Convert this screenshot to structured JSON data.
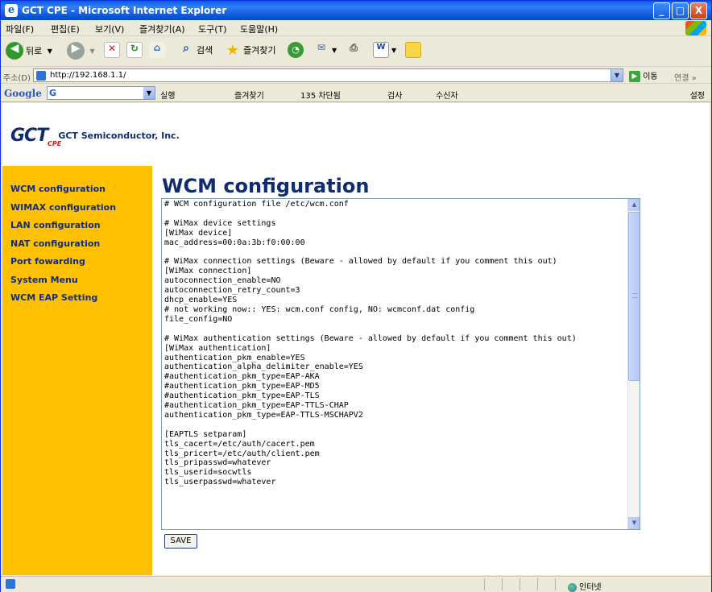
{
  "window": {
    "title": "GCT CPE - Microsoft Internet Explorer",
    "controls": {
      "minimize": "_",
      "maximize": "□",
      "close": "X"
    }
  },
  "menu": {
    "items": [
      "파일(F)",
      "편집(E)",
      "보기(V)",
      "즐겨찾기(A)",
      "도구(T)",
      "도움말(H)"
    ]
  },
  "toolbar": {
    "back_label": "뒤로",
    "search_label": "검색",
    "favorites_label": "즐겨찾기"
  },
  "address": {
    "label": "주소(D)",
    "url": "http://192.168.1.1/",
    "go_label": "이동",
    "links_label": "연결 »"
  },
  "google_toolbar": {
    "logo": "Google",
    "search_badge": "G",
    "items": [
      "실행",
      "즐겨찾기",
      "135 차단됨",
      "검사",
      "수신자"
    ],
    "settings_label": "설정"
  },
  "page": {
    "logo_mark": "GCT",
    "logo_sub": "CPE",
    "company": "GCT Semiconductor, Inc.",
    "title": "WCM configuration",
    "nav": [
      "WCM configuration",
      "WIMAX configuration",
      "LAN configuration",
      "NAT configuration",
      "Port fowarding",
      "System Menu",
      "WCM EAP Setting"
    ],
    "config_text": "# WCM configuration file /etc/wcm.conf\n\n# WiMax device settings\n[WiMax device]\nmac_address=00:0a:3b:f0:00:00\n\n# WiMax connection settings (Beware - allowed by default if you comment this out)\n[WiMax connection]\nautoconnection_enable=NO\nautoconnection_retry_count=3\ndhcp_enable=YES\n# not working now:: YES: wcm.conf config, NO: wcmconf.dat config\nfile_config=NO\n\n# WiMax authentication settings (Beware - allowed by default if you comment this out)\n[WiMax authentication]\nauthentication_pkm_enable=YES\nauthentication_alpha_delimiter_enable=YES\n#authentication_pkm_type=EAP-AKA\n#authentication_pkm_type=EAP-MD5\n#authentication_pkm_type=EAP-TLS\n#authentication_pkm_type=EAP-TTLS-CHAP\nauthentication_pkm_type=EAP-TTLS-MSCHAPV2\n\n[EAPTLS setparam]\ntls_cacert=/etc/auth/cacert.pem\ntls_pricert=/etc/auth/client.pem\ntls_pripasswd=whatever\ntls_userid=socwtls\ntls_userpasswd=whatever",
    "save_label": "SAVE"
  },
  "status": {
    "zone": "인터넷"
  }
}
